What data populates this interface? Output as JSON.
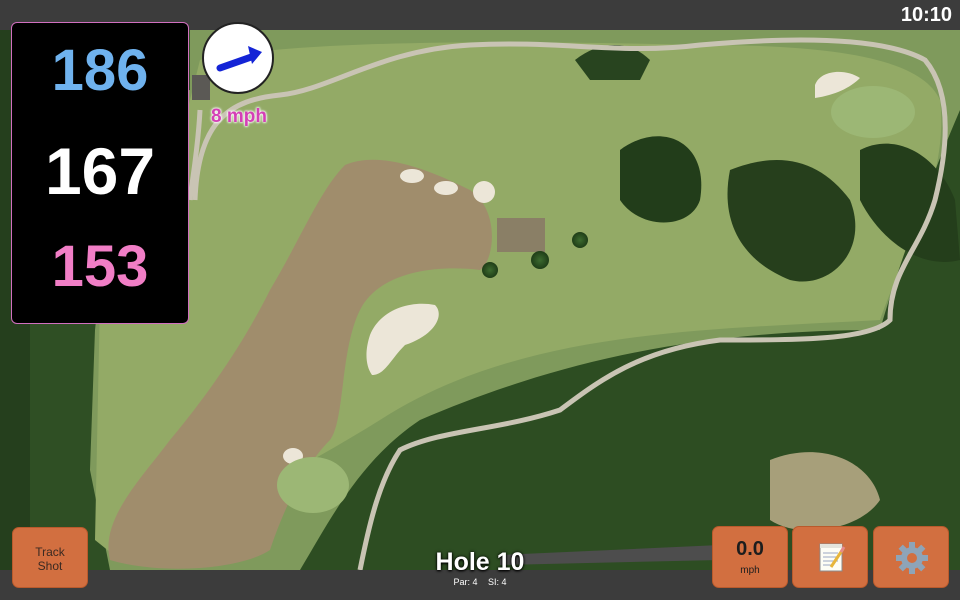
{
  "status": {
    "time": "10:10"
  },
  "distances": {
    "back": "186",
    "center": "167",
    "front": "153"
  },
  "wind": {
    "speed_label": "8 mph",
    "icon": "arrow-icon"
  },
  "hole": {
    "title": "Hole 10",
    "par_label": "Par: 4",
    "si_label": "SI: 4"
  },
  "buttons": {
    "track_line1": "Track",
    "track_line2": "Shot",
    "wind_value": "0.0",
    "wind_unit": "mph",
    "notes_icon": "notepad-icon",
    "settings_icon": "gear-icon"
  },
  "colors": {
    "button": "#d26f40",
    "back_distance": "#6fb2ee",
    "center_distance": "#ffffff",
    "front_distance": "#f17ec6",
    "wind_text": "#d43fb6"
  }
}
